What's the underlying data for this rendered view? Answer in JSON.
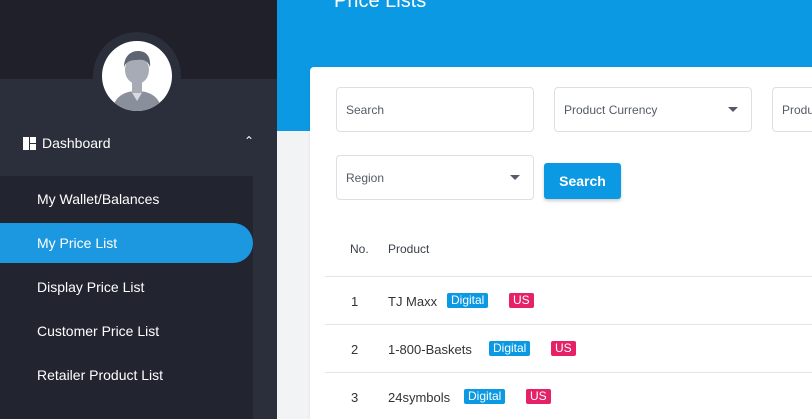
{
  "header": {
    "title": "Price Lists"
  },
  "sidebar": {
    "dashboard_label": "Dashboard",
    "items": [
      {
        "label": "My Wallet/Balances",
        "active": false
      },
      {
        "label": "My Price List",
        "active": true
      },
      {
        "label": "Display Price List",
        "active": false
      },
      {
        "label": "Customer Price List",
        "active": false
      },
      {
        "label": "Retailer Product List",
        "active": false
      }
    ]
  },
  "filters": {
    "search_placeholder": "Search",
    "currency_placeholder": "Product Currency",
    "product_placeholder": "Produ",
    "region_placeholder": "Region",
    "search_button": "Search"
  },
  "table": {
    "columns": [
      "No.",
      "Product"
    ],
    "rows": [
      {
        "no": "1",
        "product": "TJ Maxx",
        "type": "Digital",
        "region": "US"
      },
      {
        "no": "2",
        "product": "1-800-Baskets",
        "type": "Digital",
        "region": "US"
      },
      {
        "no": "3",
        "product": "24symbols",
        "type": "Digital",
        "region": "US"
      }
    ]
  },
  "colors": {
    "accent": "#0b99e3",
    "sidebar": "#2b2e3b",
    "badge_digital": "#0b99e3",
    "badge_region": "#e52167"
  }
}
